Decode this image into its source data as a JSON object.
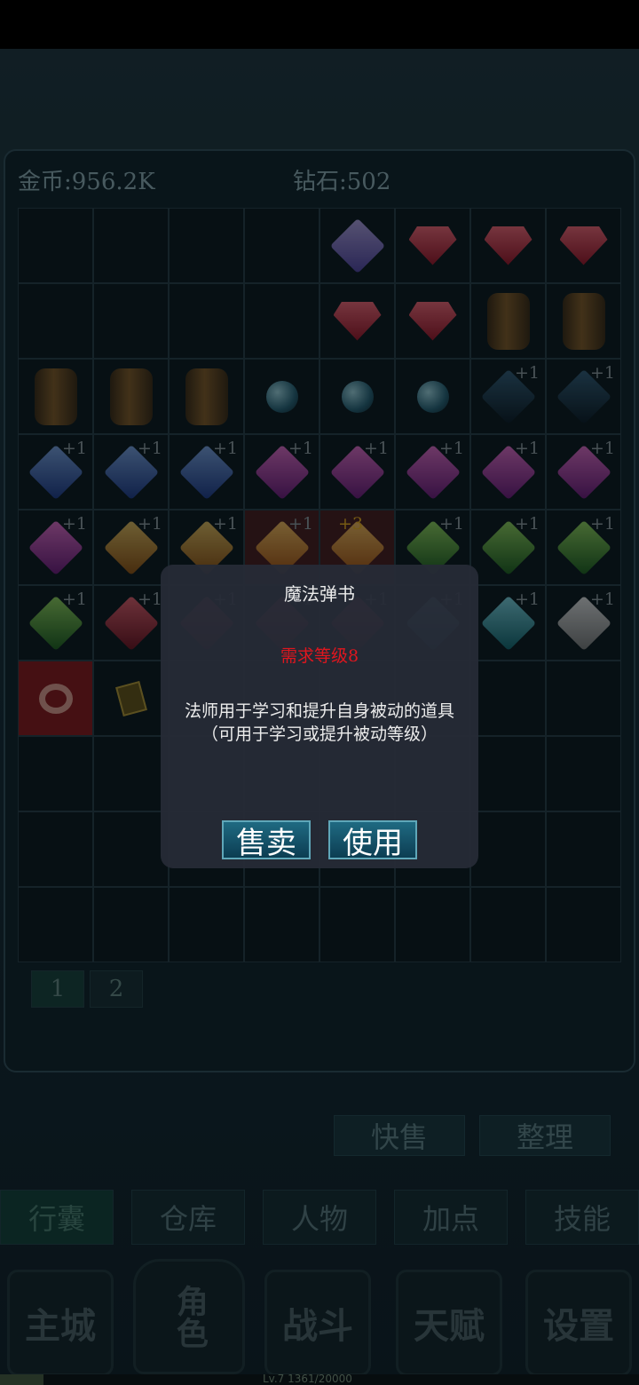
{
  "currency": {
    "gold": "金币:956.2K",
    "diamond": "钻石:502"
  },
  "inventory": {
    "slots": [
      {
        "item": "",
        "plus": ""
      },
      {
        "item": "",
        "plus": ""
      },
      {
        "item": "",
        "plus": ""
      },
      {
        "item": "",
        "plus": ""
      },
      {
        "item": "gem-purple-icon",
        "plus": ""
      },
      {
        "item": "ruby-icon",
        "plus": ""
      },
      {
        "item": "ruby-icon",
        "plus": ""
      },
      {
        "item": "ruby-icon",
        "plus": ""
      },
      {
        "item": "",
        "plus": ""
      },
      {
        "item": "",
        "plus": ""
      },
      {
        "item": "",
        "plus": ""
      },
      {
        "item": "",
        "plus": ""
      },
      {
        "item": "ruby-icon",
        "plus": ""
      },
      {
        "item": "ruby-icon",
        "plus": ""
      },
      {
        "item": "barrel-icon",
        "plus": ""
      },
      {
        "item": "barrel-icon",
        "plus": ""
      },
      {
        "item": "barrel-icon",
        "plus": ""
      },
      {
        "item": "barrel-icon",
        "plus": ""
      },
      {
        "item": "barrel-icon",
        "plus": ""
      },
      {
        "item": "orb-icon",
        "plus": ""
      },
      {
        "item": "orb-icon",
        "plus": ""
      },
      {
        "item": "orb-icon",
        "plus": ""
      },
      {
        "item": "crystal-dark-icon",
        "plus": "+1"
      },
      {
        "item": "crystal-dark-icon",
        "plus": "+1"
      },
      {
        "item": "gem-blue-icon",
        "plus": "+1"
      },
      {
        "item": "gem-blue-icon",
        "plus": "+1"
      },
      {
        "item": "gem-blue-icon",
        "plus": "+1"
      },
      {
        "item": "gem-magenta-icon",
        "plus": "+1"
      },
      {
        "item": "gem-magenta-icon",
        "plus": "+1"
      },
      {
        "item": "gem-magenta-icon",
        "plus": "+1"
      },
      {
        "item": "gem-magenta-icon",
        "plus": "+1"
      },
      {
        "item": "gem-magenta-icon",
        "plus": "+1"
      },
      {
        "item": "gem-magenta-icon",
        "plus": "+1"
      },
      {
        "item": "gem-orange-icon",
        "plus": "+1"
      },
      {
        "item": "gem-orange-icon",
        "plus": "+1"
      },
      {
        "item": "gem-orange-icon",
        "plus": "+1"
      },
      {
        "item": "gem-orange-icon",
        "plus": "+3"
      },
      {
        "item": "gem-green-icon",
        "plus": "+1"
      },
      {
        "item": "gem-green-icon",
        "plus": "+1"
      },
      {
        "item": "gem-green-icon",
        "plus": "+1"
      },
      {
        "item": "gem-green-icon",
        "plus": "+1"
      },
      {
        "item": "gem-red-icon",
        "plus": "+1"
      },
      {
        "item": "gem-red-icon",
        "plus": "+1"
      },
      {
        "item": "gem-red-icon",
        "plus": "+1"
      },
      {
        "item": "gem-red-icon",
        "plus": "+1"
      },
      {
        "item": "gem-cyan-icon",
        "plus": "+1"
      },
      {
        "item": "gem-cyan-icon",
        "plus": "+1"
      },
      {
        "item": "gem-white-icon",
        "plus": "+1"
      },
      {
        "item": "ring-icon",
        "plus": ""
      },
      {
        "item": "spellbook-icon",
        "plus": ""
      },
      {
        "item": "",
        "plus": ""
      },
      {
        "item": "",
        "plus": ""
      },
      {
        "item": "",
        "plus": ""
      },
      {
        "item": "",
        "plus": ""
      },
      {
        "item": "",
        "plus": ""
      },
      {
        "item": "",
        "plus": ""
      }
    ],
    "pages": [
      "1",
      "2"
    ]
  },
  "actions": {
    "quick_sell": "快售",
    "sort": "整理"
  },
  "tabs": [
    "行囊",
    "仓库",
    "人物",
    "加点",
    "技能"
  ],
  "nav": {
    "city": "主城",
    "character": "角色",
    "battle": "战斗",
    "talent": "天赋",
    "settings": "设置"
  },
  "xp": {
    "text": "Lv.7   1361/20000",
    "fraction": 0.068
  },
  "dialog": {
    "title": "魔法弹书",
    "requirement": "需求等级8",
    "desc_line1": "法师用于学习和提升自身被动的道具",
    "desc_line2": "（可用于学习或提升被动等级）",
    "sell_label": "售卖",
    "use_label": "使用"
  },
  "colors": {
    "requirement": "#e0161e",
    "dialog_bg": "#262a36",
    "button_bg": "#1f6a82"
  }
}
